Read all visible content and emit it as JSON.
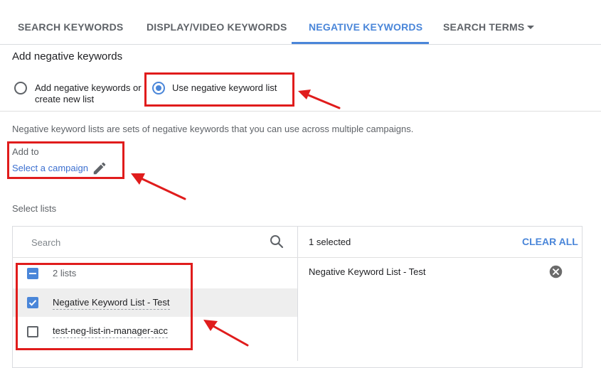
{
  "tabs": [
    {
      "label": "SEARCH KEYWORDS",
      "active": false
    },
    {
      "label": "DISPLAY/VIDEO KEYWORDS",
      "active": false
    },
    {
      "label": "NEGATIVE KEYWORDS",
      "active": true
    },
    {
      "label": "SEARCH TERMS",
      "active": false
    }
  ],
  "section_title": "Add negative keywords",
  "options": {
    "add_new": {
      "label_line1": "Add negative keywords or",
      "label_line2": "create new list",
      "checked": false
    },
    "use_list": {
      "label": "Use negative keyword list",
      "checked": true
    }
  },
  "description": "Negative keyword lists are sets of negative keywords that you can use across multiple campaigns.",
  "add_to": {
    "label": "Add to",
    "link": "Select a campaign"
  },
  "select_lists_label": "Select lists",
  "search": {
    "placeholder": "Search",
    "value": ""
  },
  "list_panel": {
    "count_label": "2 lists",
    "items": [
      {
        "name": "Negative Keyword List - Test",
        "checked": true
      },
      {
        "name": "test-neg-list-in-manager-acc",
        "checked": false
      }
    ]
  },
  "selected_panel": {
    "count_label": "1 selected",
    "clear_all": "CLEAR ALL",
    "items": [
      "Negative Keyword List - Test"
    ]
  },
  "colors": {
    "accent": "#4a86d9",
    "annotation": "#e01c1c",
    "link": "#3b6fd0"
  },
  "icons": [
    "dropdown-arrow-icon",
    "pencil-icon",
    "search-icon",
    "checkbox-icon",
    "close-circle-icon",
    "annotation-arrow-icon"
  ]
}
